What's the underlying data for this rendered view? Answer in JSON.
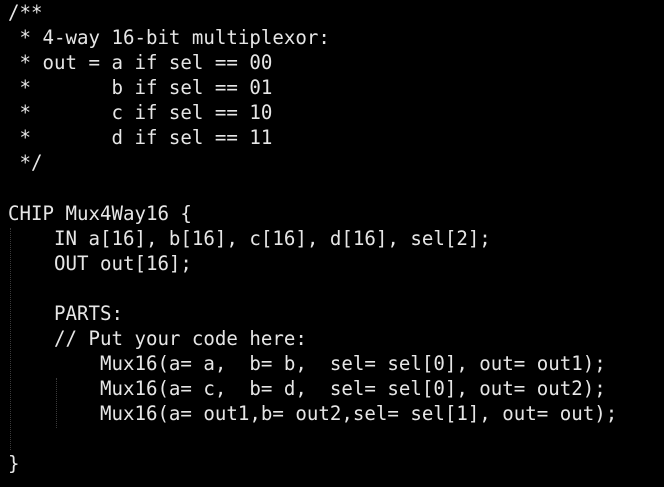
{
  "editor": {
    "lines": [
      "/**",
      " * 4-way 16-bit multiplexor:",
      " * out = a if sel == 00",
      " *       b if sel == 01",
      " *       c if sel == 10",
      " *       d if sel == 11",
      " */",
      "",
      "CHIP Mux4Way16 {",
      "    IN a[16], b[16], c[16], d[16], sel[2];",
      "    OUT out[16];",
      "",
      "    PARTS:",
      "    // Put your code here:",
      "        Mux16(a= a,  b= b,  sel= sel[0], out= out1);",
      "        Mux16(a= c,  b= d,  sel= sel[0], out= out2);",
      "        Mux16(a= out1,b= out2,sel= sel[1], out= out);",
      "",
      "}"
    ]
  },
  "colors": {
    "background": "#000000",
    "text": "#e6e6e6",
    "indent_guide": "#3a3a3a"
  }
}
